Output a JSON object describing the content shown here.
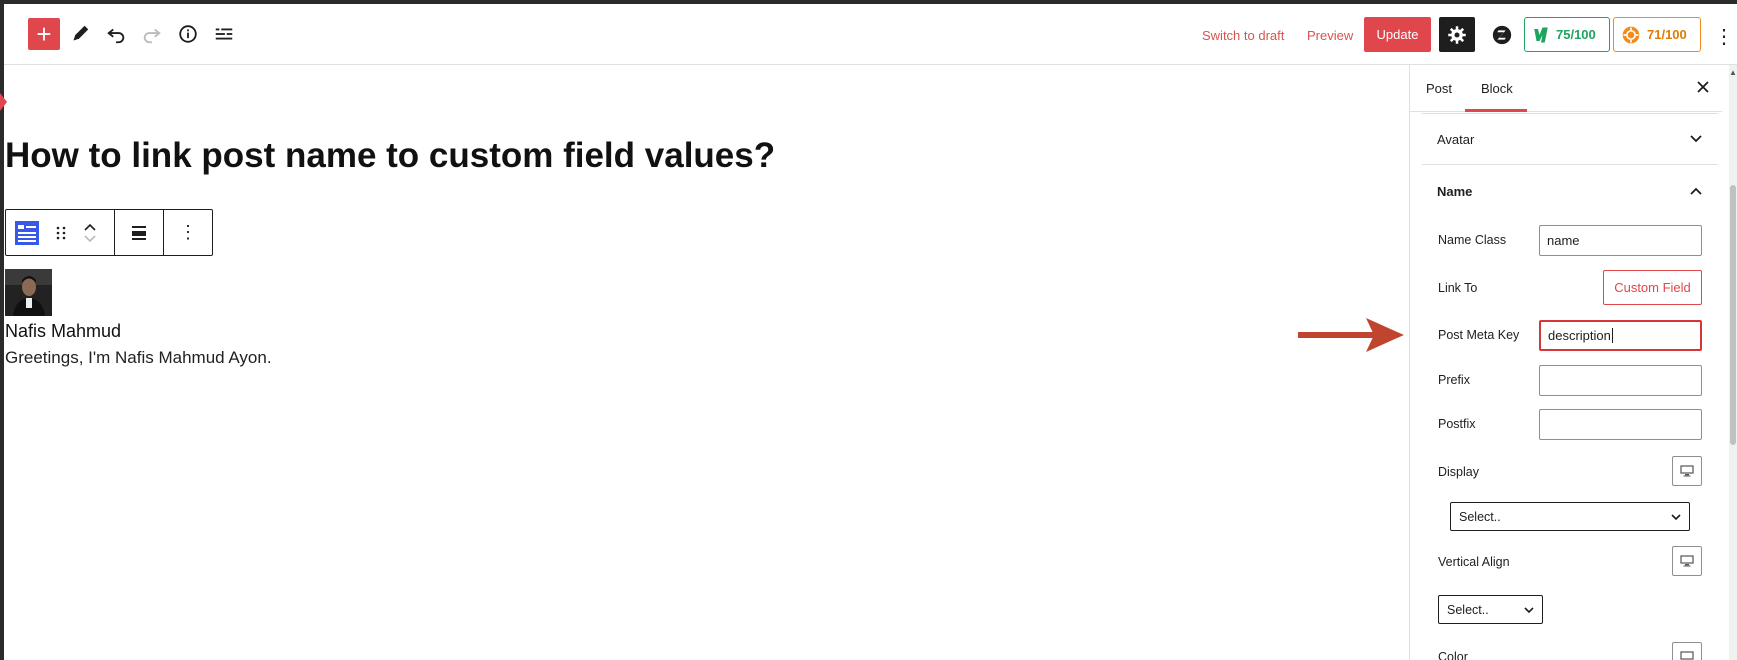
{
  "toolbar": {
    "switch_to_draft": "Switch to draft",
    "preview": "Preview",
    "update": "Update",
    "seo_score_green": "75/100",
    "seo_score_orange": "71/100",
    "accent_color": "#e0474c"
  },
  "editor": {
    "post_title": "How to link post name to custom field values?",
    "author_name": "Nafis Mahmud",
    "author_description": "Greetings, I'm Nafis Mahmud Ayon."
  },
  "sidebar": {
    "tabs": [
      {
        "label": "Post",
        "active": false
      },
      {
        "label": "Block",
        "active": true
      }
    ],
    "panels": {
      "avatar": {
        "title": "Avatar",
        "expanded": false
      },
      "name": {
        "title": "Name",
        "expanded": true
      }
    },
    "fields": {
      "name_class": {
        "label": "Name Class",
        "value": "name"
      },
      "link_to": {
        "label": "Link To",
        "value": "Custom Field"
      },
      "post_meta_key": {
        "label": "Post Meta Key",
        "value": "description"
      },
      "prefix": {
        "label": "Prefix",
        "value": ""
      },
      "postfix": {
        "label": "Postfix",
        "value": ""
      },
      "display": {
        "label": "Display",
        "value": "Select.."
      },
      "vertical_align": {
        "label": "Vertical Align",
        "value": "Select.."
      },
      "color": {
        "label": "Color"
      }
    }
  },
  "icons": [
    "plus-icon",
    "pencil-icon",
    "undo-icon",
    "redo-icon",
    "info-icon",
    "list-view-icon",
    "gear-icon",
    "zap-icon",
    "rank-math-icon",
    "seo-gear-icon",
    "more-vertical-icon",
    "close-icon",
    "chevron-down-icon",
    "chevron-up-icon",
    "desktop-icon",
    "arrow-icon"
  ]
}
